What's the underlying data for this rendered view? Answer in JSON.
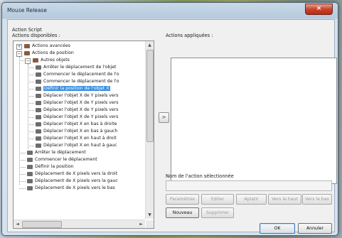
{
  "window": {
    "title": "Mouse Release",
    "close_glyph": "×"
  },
  "labels": {
    "group": "Action Script",
    "available": "Actions disponibles :",
    "applied": "Actions appliquées :",
    "selected_name": "Nom de l'action sélectionnée"
  },
  "tree": {
    "selected_index": 7,
    "rows": [
      {
        "label": "Actions avancées",
        "depth": 0,
        "type": "group",
        "expander": "+"
      },
      {
        "label": "Actions de position",
        "depth": 0,
        "type": "group",
        "expander": "−"
      },
      {
        "label": "Autres objets",
        "depth": 1,
        "type": "group",
        "expander": "−"
      },
      {
        "label": "Arrêter le déplacement de l'objet",
        "depth": 2,
        "type": "action"
      },
      {
        "label": "Commencer le déplacement de l'o",
        "depth": 2,
        "type": "action"
      },
      {
        "label": "Commencer le déplacement de l'o",
        "depth": 2,
        "type": "action"
      },
      {
        "label": "Définir la position de l'objet X",
        "depth": 2,
        "type": "action"
      },
      {
        "label": "Déplacer l'objet X de Y pixels vers",
        "depth": 2,
        "type": "action"
      },
      {
        "label": "Déplacer l'objet X de Y pixels vers",
        "depth": 2,
        "type": "action"
      },
      {
        "label": "Déplacer l'objet X de Y pixels vers",
        "depth": 2,
        "type": "action"
      },
      {
        "label": "Déplacer l'objet X de Y pixels vers",
        "depth": 2,
        "type": "action"
      },
      {
        "label": "Déplacer l'objet X en bas à droite",
        "depth": 2,
        "type": "action"
      },
      {
        "label": "Déplacer l'objet X en bas à gauch",
        "depth": 2,
        "type": "action"
      },
      {
        "label": "Déplacer l'objet X en haut à droit",
        "depth": 2,
        "type": "action"
      },
      {
        "label": "Déplacer l'objet X en haut à gauc",
        "depth": 2,
        "type": "action"
      },
      {
        "label": "Arrêter le déplacement",
        "depth": 1,
        "type": "action"
      },
      {
        "label": "Commencer le déplacement",
        "depth": 1,
        "type": "action"
      },
      {
        "label": "Définir la position",
        "depth": 1,
        "type": "action"
      },
      {
        "label": "Déplacement de X pixels vers la droit",
        "depth": 1,
        "type": "action"
      },
      {
        "label": "Déplacement de X pixels vers la gauc",
        "depth": 1,
        "type": "action"
      },
      {
        "label": "Déplacement de X pixels vers le bas",
        "depth": 1,
        "type": "action"
      }
    ]
  },
  "buttons": {
    "add": ">",
    "parameters": "Paramètres",
    "edit": "Editer",
    "delete": "Aplatir",
    "move_up": "Vers le haut",
    "move_down": "Vers le bas",
    "new": "Nouveau",
    "remove": "Supprimer",
    "ok": "OK",
    "cancel": "Annuler"
  },
  "scroll": {
    "left_arrow": "◄",
    "right_arrow": "►",
    "up_arrow": "▲",
    "down_arrow": "▼"
  },
  "icons": {
    "tree_action": "script-action-icon",
    "tree_group": "folder-icon"
  }
}
